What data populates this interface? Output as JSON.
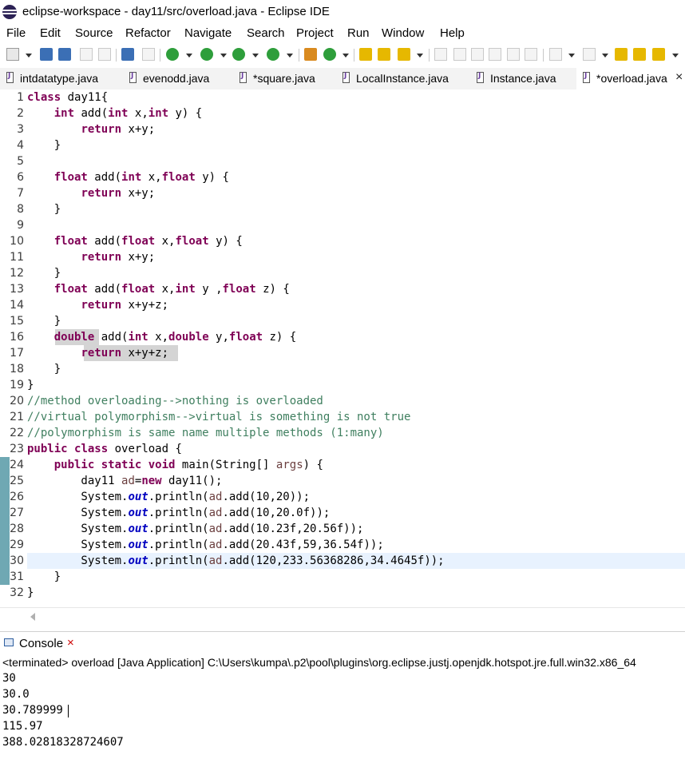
{
  "window": {
    "title": "eclipse-workspace - day11/src/overload.java - Eclipse IDE"
  },
  "menu": [
    "File",
    "Edit",
    "Source",
    "Refactor",
    "Navigate",
    "Search",
    "Project",
    "Run",
    "Window",
    "Help"
  ],
  "tabs": [
    {
      "label": "intdatatype.java",
      "active": false
    },
    {
      "label": "evenodd.java",
      "active": false
    },
    {
      "label": "*square.java",
      "active": false
    },
    {
      "label": "LocalInstance.java",
      "active": false
    },
    {
      "label": "Instance.java",
      "active": false
    },
    {
      "label": "*overload.java",
      "active": true,
      "close": "×"
    }
  ],
  "editor": {
    "current_line": 30,
    "line_numbers": [
      "1",
      "2",
      "3",
      "4",
      "5",
      "6",
      "7",
      "8",
      "9",
      "10",
      "11",
      "12",
      "13",
      "14",
      "15",
      "16",
      "17",
      "18",
      "19",
      "20",
      "21",
      "22",
      "23",
      "24",
      "25",
      "26",
      "27",
      "28",
      "29",
      "30",
      "31",
      "32"
    ],
    "lines": [
      "class day11{",
      "    int add(int x,int y) {",
      "        return x+y;",
      "    }",
      "",
      "    float add(int x,float y) {",
      "        return x+y;",
      "    }",
      "",
      "    float add(float x,float y) {",
      "        return x+y;",
      "    }",
      "    float add(float x,int y ,float z) {",
      "        return x+y+z;",
      "    }",
      "    double add(int x,double y,float z) {",
      "        return x+y+z;",
      "    }",
      "}",
      "//method overloading-->nothing is overloaded",
      "//virtual polymorphism-->virtual is something is not true",
      "//polymorphism is same name multiple methods (1:many)",
      "public class overload {",
      "    public static void main(String[] args) {",
      "        day11 ad=new day11();",
      "        System.out.println(ad.add(10,20));",
      "        System.out.println(ad.add(10,20.0f));",
      "        System.out.println(ad.add(10.23f,20.56f));",
      "        System.out.println(ad.add(20.43f,59,36.54f));",
      "        System.out.println(ad.add(120,233.56368286,34.4645f));",
      "    }",
      "}"
    ]
  },
  "console": {
    "tab_label": "Console",
    "close": "×",
    "terminated": "<terminated> overload [Java Application] C:\\Users\\kumpa\\.p2\\pool\\plugins\\org.eclipse.justj.openjdk.hotspot.jre.full.win32.x86_64",
    "output": [
      "30",
      "30.0",
      "30.789999",
      "115.97",
      "388.02818328724607"
    ]
  },
  "colors": {
    "keyword": "#7f0055",
    "comment": "#3f7f5f",
    "static_field": "#0000c0",
    "current_line": "#e8f2fe"
  }
}
